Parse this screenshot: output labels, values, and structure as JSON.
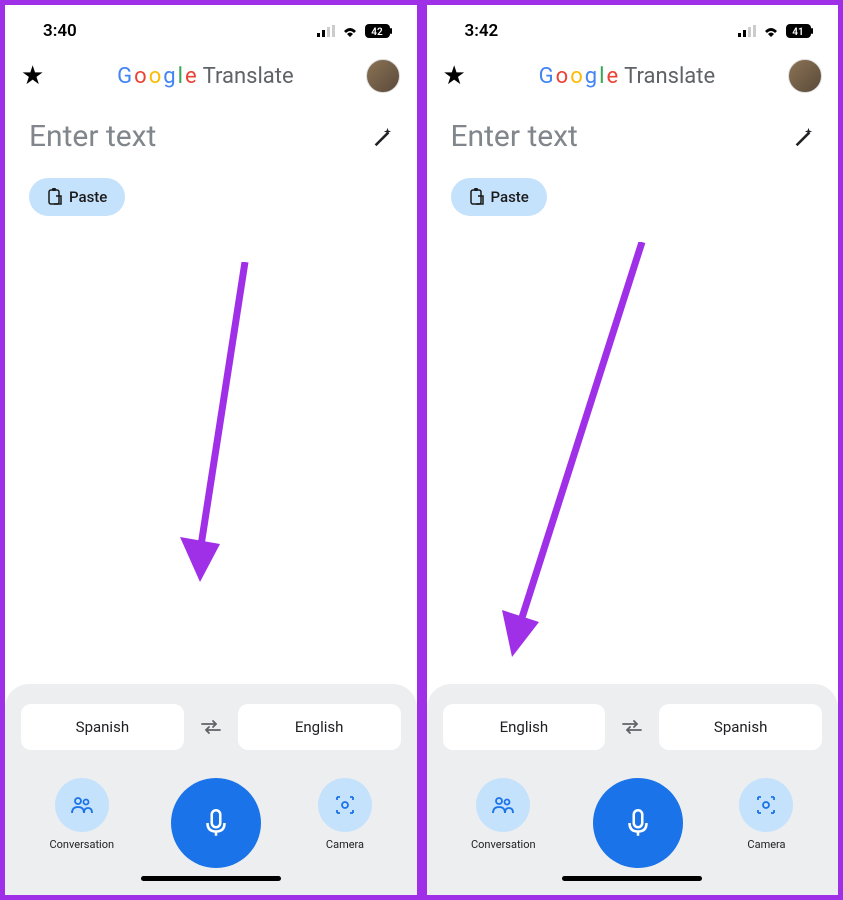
{
  "screens": [
    {
      "time": "3:40",
      "battery": "42",
      "appName": {
        "g": "G",
        "o1": "o",
        "o2": "o",
        "g2": "g",
        "l": "l",
        "e": "e",
        "translate": "Translate"
      },
      "placeholder": "Enter text",
      "pasteLabel": "Paste",
      "langSource": "Spanish",
      "langTarget": "English",
      "conversationLabel": "Conversation",
      "cameraLabel": "Camera"
    },
    {
      "time": "3:42",
      "battery": "41",
      "appName": {
        "g": "G",
        "o1": "o",
        "o2": "o",
        "g2": "g",
        "l": "l",
        "e": "e",
        "translate": "Translate"
      },
      "placeholder": "Enter text",
      "pasteLabel": "Paste",
      "langSource": "English",
      "langTarget": "Spanish",
      "conversationLabel": "Conversation",
      "cameraLabel": "Camera"
    }
  ]
}
